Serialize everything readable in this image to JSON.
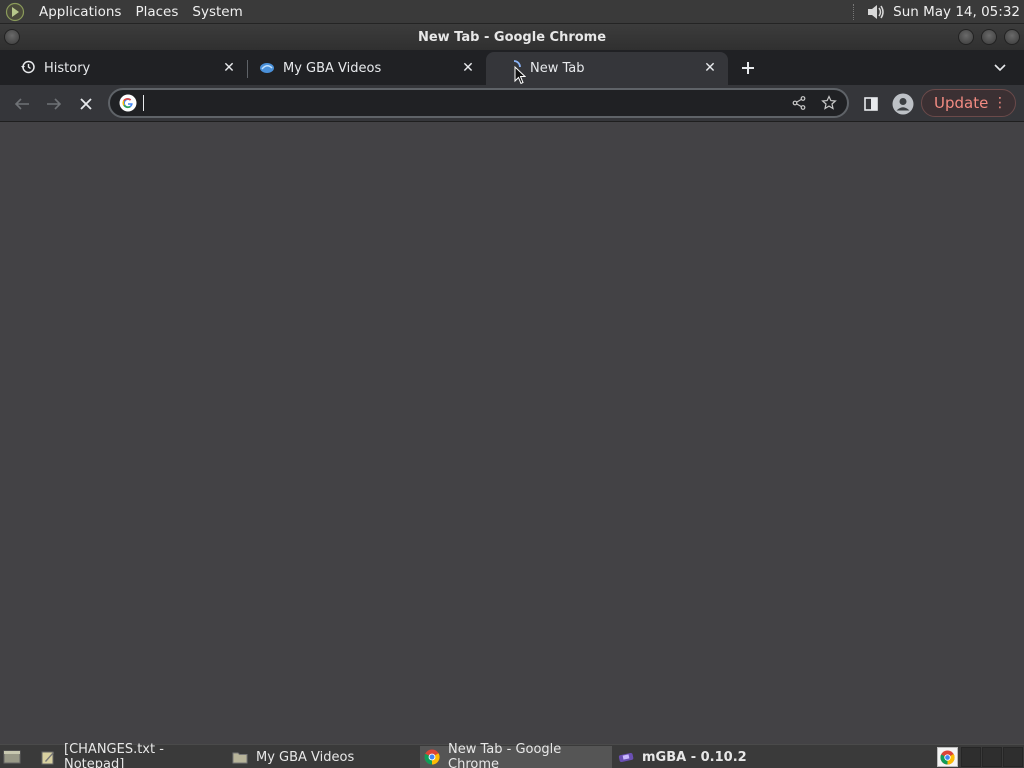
{
  "top_panel": {
    "menus": [
      "Applications",
      "Places",
      "System"
    ],
    "clock": "Sun May 14, 05:32"
  },
  "window": {
    "title": "New Tab - Google Chrome"
  },
  "tabs": [
    {
      "label": "History",
      "icon": "history-icon"
    },
    {
      "label": "My GBA Videos",
      "icon": "drive-icon"
    },
    {
      "label": "New Tab",
      "icon": "loading-spinner-icon",
      "active": true
    }
  ],
  "toolbar": {
    "omnibox_value": "",
    "update_label": "Update"
  },
  "taskbar": {
    "items": [
      {
        "label": "[CHANGES.txt - Notepad]",
        "icon": "notepad-icon"
      },
      {
        "label": "My GBA Videos",
        "icon": "folder-icon"
      },
      {
        "label": "New Tab - Google Chrome",
        "icon": "chrome-icon",
        "active": true
      },
      {
        "label": "mGBA - 0.10.2",
        "icon": "mgba-icon",
        "bold": true
      }
    ]
  },
  "colors": {
    "tabstrip": "#202124",
    "toolbar": "#35363a",
    "content": "#434245",
    "update_text": "#f28b82"
  }
}
